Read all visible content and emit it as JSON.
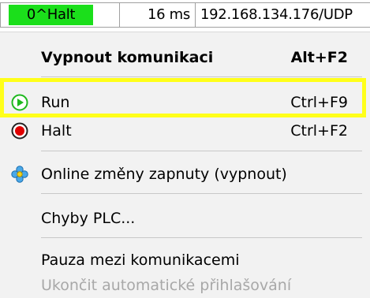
{
  "statusbar": {
    "state": "0^Halt",
    "cycle_time": "16 ms",
    "address": "192.168.134.176/UDP"
  },
  "menu": {
    "items": [
      {
        "label": "Vypnout komunikaci",
        "shortcut": "Alt+F2"
      },
      {
        "label": "Run",
        "shortcut": "Ctrl+F9",
        "icon": "run-icon"
      },
      {
        "label": "Halt",
        "shortcut": "Ctrl+F2",
        "icon": "halt-icon"
      },
      {
        "label": "Online změny zapnuty (vypnout)",
        "icon": "online-changes-icon"
      },
      {
        "label": "Chyby PLC..."
      },
      {
        "label": "Pauza mezi komunikacemi"
      },
      {
        "label": "Ukončit automatické přihlašování"
      }
    ]
  },
  "colors": {
    "status_green": "#1bdf1b",
    "highlight_yellow": "#ffff1a",
    "run_icon": "#1eb81e",
    "halt_icon": "#e00000",
    "disabled_text": "#a8a8a8"
  }
}
